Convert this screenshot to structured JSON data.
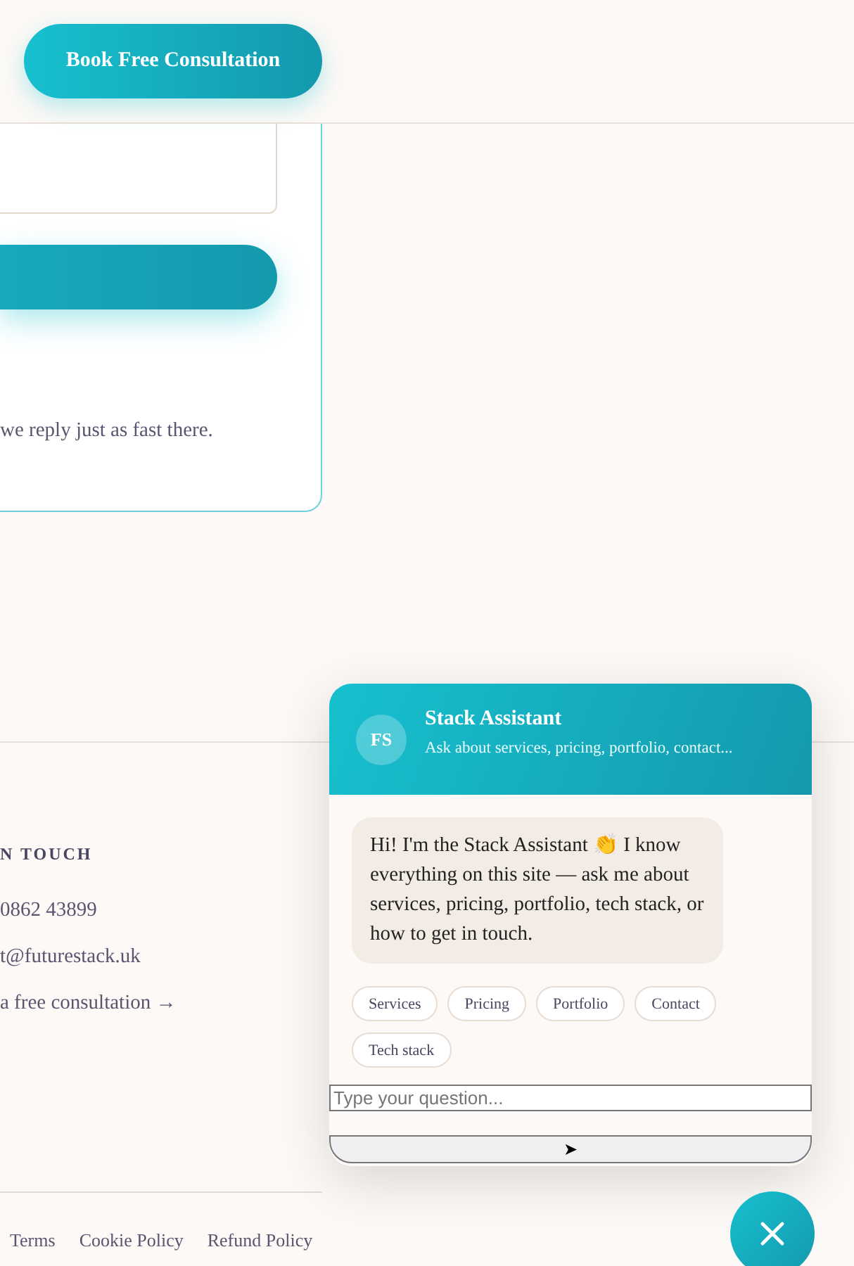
{
  "header": {
    "cta_button": "Book Free Consultation"
  },
  "contact_card": {
    "note": "we reply just as fast there."
  },
  "footer": {
    "heading": "N TOUCH",
    "contacts": [
      "0862 43899",
      "t@futurestack.uk",
      "a free consultation →"
    ],
    "legal_links": [
      "Terms",
      "Cookie Policy",
      "Refund Policy"
    ]
  },
  "chat": {
    "avatar": "FS",
    "title": "Stack Assistant",
    "subtitle": "Ask about services, pricing, portfolio, contact...",
    "messages": [
      {
        "kind": "bot",
        "text": "Hi! I'm the Stack Assistant 👏 I know everything on this site — ask me about services, pricing, portfolio, tech stack, or how to get in touch."
      }
    ],
    "suggestions": [
      "Services",
      "Pricing",
      "Portfolio",
      "Contact",
      "Tech stack"
    ],
    "input": {
      "placeholder": "Type your question..."
    },
    "send_button": "➤",
    "open": true
  }
}
